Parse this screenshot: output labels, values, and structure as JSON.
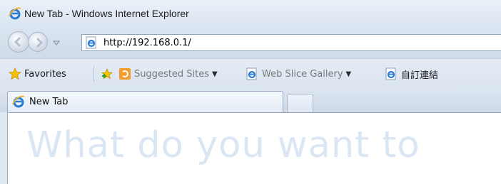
{
  "window": {
    "title": "New Tab - Windows Internet Explorer"
  },
  "navigation": {
    "address": "http://192.168.0.1/"
  },
  "favorites_bar": {
    "favorites_label": "Favorites",
    "items": [
      {
        "label": "Suggested Sites",
        "icon": "suggested-sites-icon",
        "has_dropdown": true
      },
      {
        "label": "Web Slice Gallery",
        "icon": "ie-page-icon",
        "has_dropdown": true
      },
      {
        "label": "自訂連結",
        "icon": "ie-page-icon",
        "has_dropdown": false
      }
    ]
  },
  "tabs": [
    {
      "label": "New Tab",
      "icon": "ie-logo-icon",
      "active": true
    }
  ],
  "content": {
    "headline": "What do you want to"
  },
  "colors": {
    "ie_blue": "#2a7bd4",
    "headline": "#dbe6f4",
    "suggested_orange": "#f39c2b",
    "favorites_star": "#f5c400"
  }
}
